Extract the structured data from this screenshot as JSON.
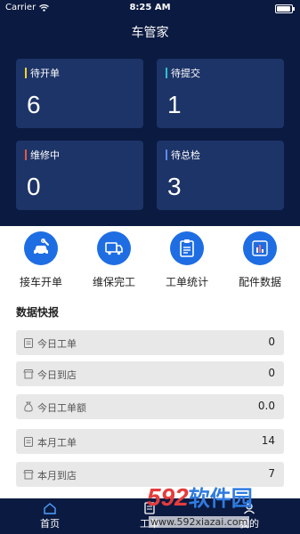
{
  "status_bar": {
    "carrier": "Carrier",
    "time": "8:25 AM"
  },
  "header": {
    "title": "车管家"
  },
  "cards": [
    {
      "label": "待开单",
      "value": "6",
      "accent": "#f5d22e"
    },
    {
      "label": "待提交",
      "value": "1",
      "accent": "#2ec2c9"
    },
    {
      "label": "维修中",
      "value": "0",
      "accent": "#e8573c"
    },
    {
      "label": "待总检",
      "value": "3",
      "accent": "#5a8df0"
    }
  ],
  "menu": [
    {
      "label": "接车开单",
      "icon": "car-service-icon"
    },
    {
      "label": "维保完工",
      "icon": "truck-icon"
    },
    {
      "label": "工单统计",
      "icon": "clipboard-icon"
    },
    {
      "label": "配件数据",
      "icon": "bar-chart-icon"
    }
  ],
  "data_report": {
    "title": "数据快报",
    "rows": [
      {
        "label": "今日工单",
        "value": "0",
        "icon": "clipboard-icon"
      },
      {
        "label": "今日到店",
        "value": "0",
        "icon": "store-icon"
      },
      {
        "label": "今日工单额",
        "value": "0.0",
        "icon": "money-bag-icon"
      },
      {
        "label": "本月工单",
        "value": "14",
        "icon": "clipboard-icon"
      },
      {
        "label": "本月到店",
        "value": "7",
        "icon": "store-icon"
      }
    ]
  },
  "tabs": [
    {
      "label": "首页",
      "icon": "home-icon"
    },
    {
      "label": "工单",
      "icon": "order-icon"
    },
    {
      "label": "我的",
      "icon": "user-icon"
    }
  ],
  "watermark": {
    "logo_text": "592",
    "logo_suffix": "软件园",
    "url": "www.592xiazai.com"
  },
  "colors": {
    "header_bg": "#0b1a40",
    "card_bg": "#1d3468",
    "accent_blue": "#1e6de3"
  }
}
